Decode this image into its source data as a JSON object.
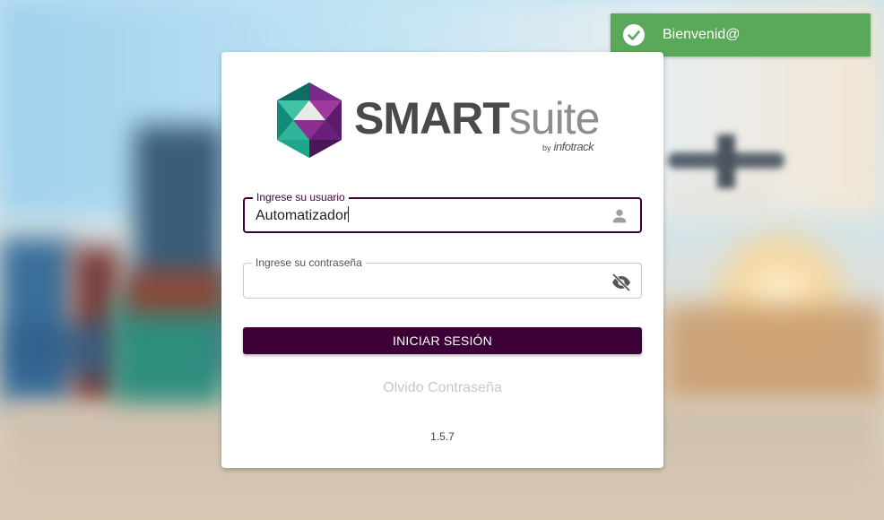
{
  "login": {
    "username_label": "Ingrese su usuario",
    "username_value": "Automatizador",
    "password_label": "Ingrese su contraseña",
    "password_value": "",
    "submit_label": "INICIAR SESIÓN",
    "forgot_label": "Olvido Contraseña",
    "version": "1.5.7"
  },
  "logo": {
    "primary": "SMART",
    "secondary": "suite",
    "by": "by",
    "brand": "infotrack"
  },
  "toast": {
    "message": "Bienvenid@",
    "icon": "check-circle-icon"
  },
  "colors": {
    "brand_purple": "#3d0036",
    "toast_green": "#5aa85a",
    "logo_teal": "#1ea88c",
    "logo_violet": "#7b2a8c"
  },
  "icons": {
    "username": "person-icon",
    "password": "eye-off-icon"
  }
}
